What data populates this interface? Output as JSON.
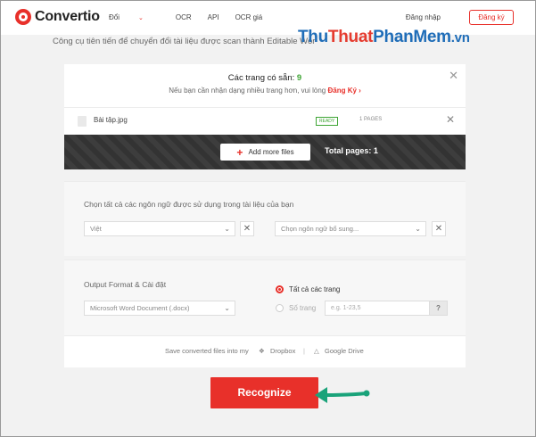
{
  "header": {
    "logo_text": "Convertio",
    "nav": [
      "Đổi",
      "OCR",
      "API",
      "OCR giá"
    ],
    "login": "Đăng nhập",
    "signup": "Đăng ký"
  },
  "tagline": "Công cụ tiên tiến để chuyển đổi tài liệu được scan thành Editable Wor",
  "watermark": {
    "p1": "Thu",
    "p2": "Thuat",
    "p3": "PhanMem",
    "p4": ".vn"
  },
  "upload": {
    "available_label": "Các trang có sẵn:",
    "available_count": "9",
    "sub_text": "Nếu bạn cần nhận dạng nhiều trang hơn, vui lòng",
    "sub_link": "Đăng Ký",
    "file_name": "Bài tập.jpg",
    "status": "READY",
    "pages": "1 PAGES",
    "add_more": "Add more files",
    "total_pages": "Total pages: 1"
  },
  "language": {
    "label": "Chọn tất cả các ngôn ngữ được sử dụng trong tài liệu của bạn",
    "primary": "Việt",
    "secondary_placeholder": "Chọn ngôn ngữ bổ sung..."
  },
  "output": {
    "label": "Output Format & Cài đặt",
    "format": "Microsoft Word Document (.docx)",
    "all_pages": "Tất cả các trang",
    "page_numbers": "Số trang",
    "page_placeholder": "e.g. 1-23,5",
    "help": "?",
    "save_text": "Save converted files into my",
    "dropbox": "Dropbox",
    "gdrive": "Google Drive"
  },
  "recognize_label": "Recognize",
  "colors": {
    "brand": "#e8302a",
    "accent_green": "#3fa535",
    "arrow": "#1aa37a"
  }
}
